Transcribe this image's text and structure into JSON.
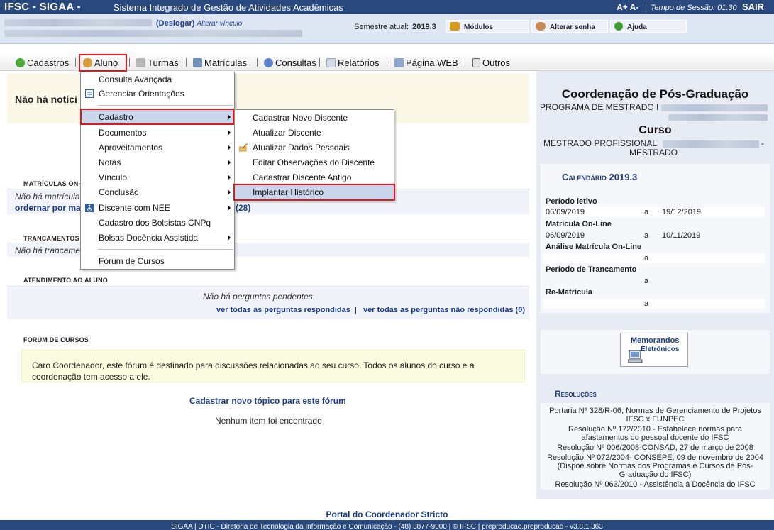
{
  "topbar": {
    "brand": "IFSC - SIGAA -",
    "system_name": "Sistema Integrado de Gestão de Atividades Acadêmicas",
    "font_controls": "A+ A-",
    "session_timer": "Tempo de Sessão: 01:30",
    "logout": "SAIR"
  },
  "userbar": {
    "deslogar": "(Deslogar)",
    "alterar_vinculo": "Alterar vínculo",
    "semestre_label": "Semestre atual:",
    "semestre_value": "2019.3",
    "buttons": [
      "Módulos",
      "Alterar senha",
      "Ajuda"
    ]
  },
  "menu": {
    "items": [
      "Cadastros",
      "Aluno",
      "Turmas",
      "Matrículas",
      "Consultas",
      "Relatórios",
      "Página WEB",
      "Outros"
    ]
  },
  "main": {
    "notice": "Não há notíci",
    "matriculas_head": "Matrículas On-L",
    "matriculas_text": "Não há matrícula",
    "matriculas_link": "ordernar por ma",
    "matriculas_count": "(28)",
    "trancamentos_head": "Trancamentos P",
    "trancamentos_text": "Não há trancame",
    "atendimento_head": "Atendimento ao Aluno",
    "atendimento_text": "Não há perguntas pendentes.",
    "link_respondidas": "ver todas as perguntas respondidas",
    "link_separator": "|",
    "link_nao_respondidas": "ver todas as perguntas não respondidas (0)",
    "forum_head": "Forum de Cursos",
    "forum_text": "Caro Coordenador, este fórum é destinado para discussões relacionadas ao seu curso. Todos os alunos do curso e a coordenação tem acesso a ele.",
    "forum_link": "Cadastrar novo tópico para este fórum",
    "forum_empty": "Nenhum item foi encontrado"
  },
  "aluno_menu": {
    "items": [
      {
        "label": "Consulta Avançada",
        "submenu": false
      },
      {
        "label": "Gerenciar Orientações",
        "submenu": false
      },
      {
        "label": "Cadastro",
        "submenu": true
      },
      {
        "label": "Documentos",
        "submenu": true
      },
      {
        "label": "Aproveitamentos",
        "submenu": true
      },
      {
        "label": "Notas",
        "submenu": true
      },
      {
        "label": "Vínculo",
        "submenu": true
      },
      {
        "label": "Conclusão",
        "submenu": true
      },
      {
        "label": "Discente com NEE",
        "submenu": true
      },
      {
        "label": "Cadastro dos Bolsistas CNPq",
        "submenu": false
      },
      {
        "label": "Bolsas Docência Assistida",
        "submenu": true
      },
      {
        "label": "Fórum de Cursos",
        "submenu": false
      }
    ]
  },
  "cadastro_menu": {
    "items": [
      "Cadastrar Novo Discente",
      "Atualizar Discente",
      "Atualizar Dados Pessoais",
      "Editar Observações do Discente",
      "Cadastrar Discente Antigo",
      "Implantar Histórico"
    ]
  },
  "right": {
    "coord_title": "Coordenação de Pós-Graduação",
    "programa": "PROGRAMA DE MESTRADO I",
    "curso_title": "Curso",
    "curso_line1": "MESTRADO PROFISSIONAL",
    "curso_dash": "-",
    "curso_line2": "MESTRADO",
    "calendario_head": "Calendário 2019.3",
    "calendar": [
      {
        "label": "Período letivo",
        "start": "06/09/2019",
        "sep": "a",
        "end": "19/12/2019"
      },
      {
        "label": "Matrícula On-Line",
        "start": "06/09/2019",
        "sep": "a",
        "end": "10/11/2019"
      },
      {
        "label": "Análise Matrícula On-Line",
        "start": "",
        "sep": "a",
        "end": ""
      },
      {
        "label": "Período de Trancamento",
        "start": "",
        "sep": "a",
        "end": ""
      },
      {
        "label": "Re-Matrícula",
        "start": "",
        "sep": "a",
        "end": ""
      }
    ],
    "memo_line1": "Memorandos",
    "memo_line2": "Eletrônicos",
    "resolucoes_head": "Resoluções",
    "resolucoes": [
      [
        "Portaria Nº 328/R-06, Normas de Gerenciamento de Projetos",
        "IFSC x FUNPEC"
      ],
      [
        "Resolução Nº 172/2010 - Estabelece normas para",
        "afastamentos do pessoal docente do IFSC"
      ],
      [
        "Resolução Nº 006/2008-CONSAD, 27 de março de 2008"
      ],
      [
        "Resolução Nº 072/2004- CONSEPE, 09 de novembro de 2004",
        "(Dispõe sobre Normas dos Programas e Cursos de Pós-",
        "Graduação do IFSC)"
      ],
      [
        "Resolução Nº 063/2010 - Assistência à Docência do IFSC"
      ]
    ]
  },
  "footer": {
    "portal": "Portal do Coordenador Stricto",
    "text": "SIGAA | DTIC - Diretoria de Tecnologia da Informação e Comunicação - (48) 3877-9000 | © IFSC | preproducao.preproducao - v3.8.1.363"
  },
  "colors": {
    "topbar": "#28487e",
    "link": "#1a3b8a",
    "highlight_outline": "#e0181c",
    "menu_highlight": "#c9d5ea"
  }
}
